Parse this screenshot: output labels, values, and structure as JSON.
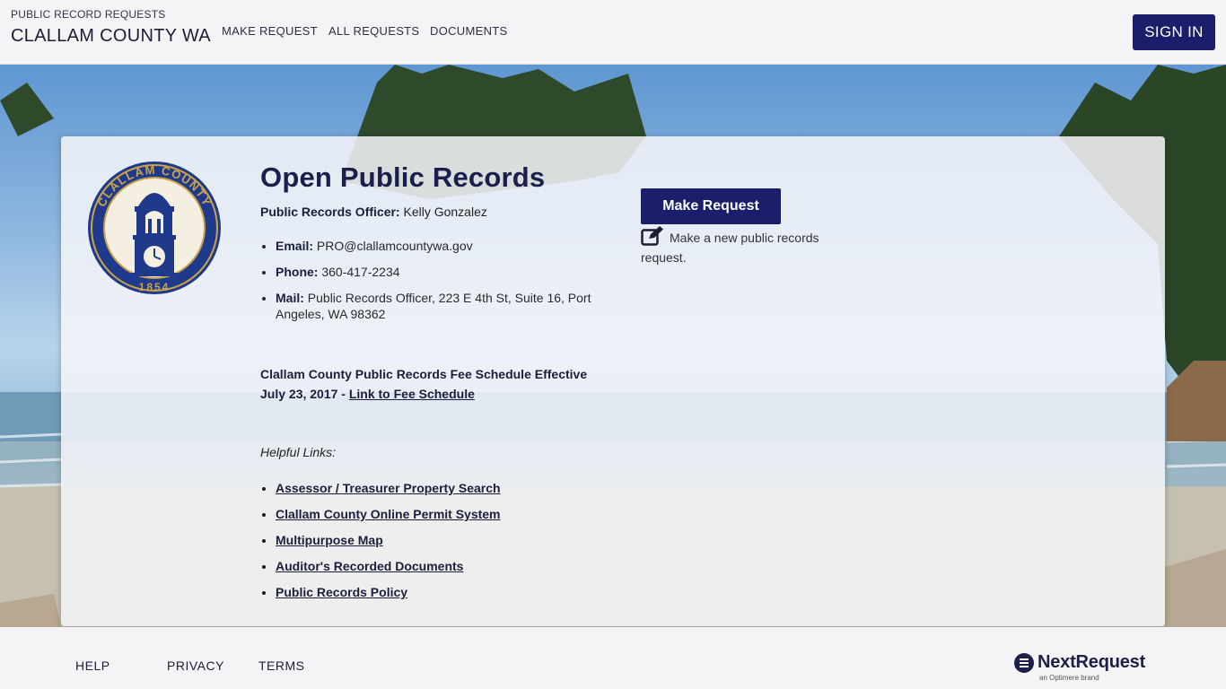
{
  "header": {
    "subtitle": "PUBLIC RECORD REQUESTS",
    "title": "CLALLAM COUNTY WA",
    "nav": [
      "MAKE REQUEST",
      "ALL REQUESTS",
      "DOCUMENTS"
    ],
    "sign_in": "SIGN IN"
  },
  "seal": {
    "top_text": "CLALLAM COUNTY",
    "year": "1854"
  },
  "main": {
    "title": "Open Public Records",
    "officer_label": "Public Records Officer:",
    "officer_name": "Kelly Gonzalez",
    "contacts": [
      {
        "label": "Email:",
        "value": "PRO@clallamcountywa.gov"
      },
      {
        "label": "Phone:",
        "value": "360-417-2234"
      },
      {
        "label": "Mail:",
        "value": "Public Records Officer, 223 E 4th St, Suite 16, Port Angeles, WA 98362"
      }
    ],
    "fee_text": "Clallam County Public Records Fee Schedule Effective July 23, 2017 -",
    "fee_link": "Link to Fee Schedule",
    "helpful_title": "Helpful Links:",
    "helpful_links": [
      "Assessor / Treasurer Property Search",
      "Clallam County Online Permit System",
      "Multipurpose Map",
      "Auditor's Recorded Documents",
      "Public Records Policy"
    ],
    "make_request_button": "Make Request",
    "make_request_desc": "Make a new public records request."
  },
  "footer": {
    "links": [
      "HELP",
      "PRIVACY",
      "TERMS"
    ],
    "brand_name": "NextRequest",
    "brand_tag": "an Optimere brand"
  },
  "colors": {
    "primary": "#1b1f6b",
    "heading": "#1b1f4b",
    "seal_blue": "#1f3a8a",
    "seal_gold": "#c9a24a"
  }
}
